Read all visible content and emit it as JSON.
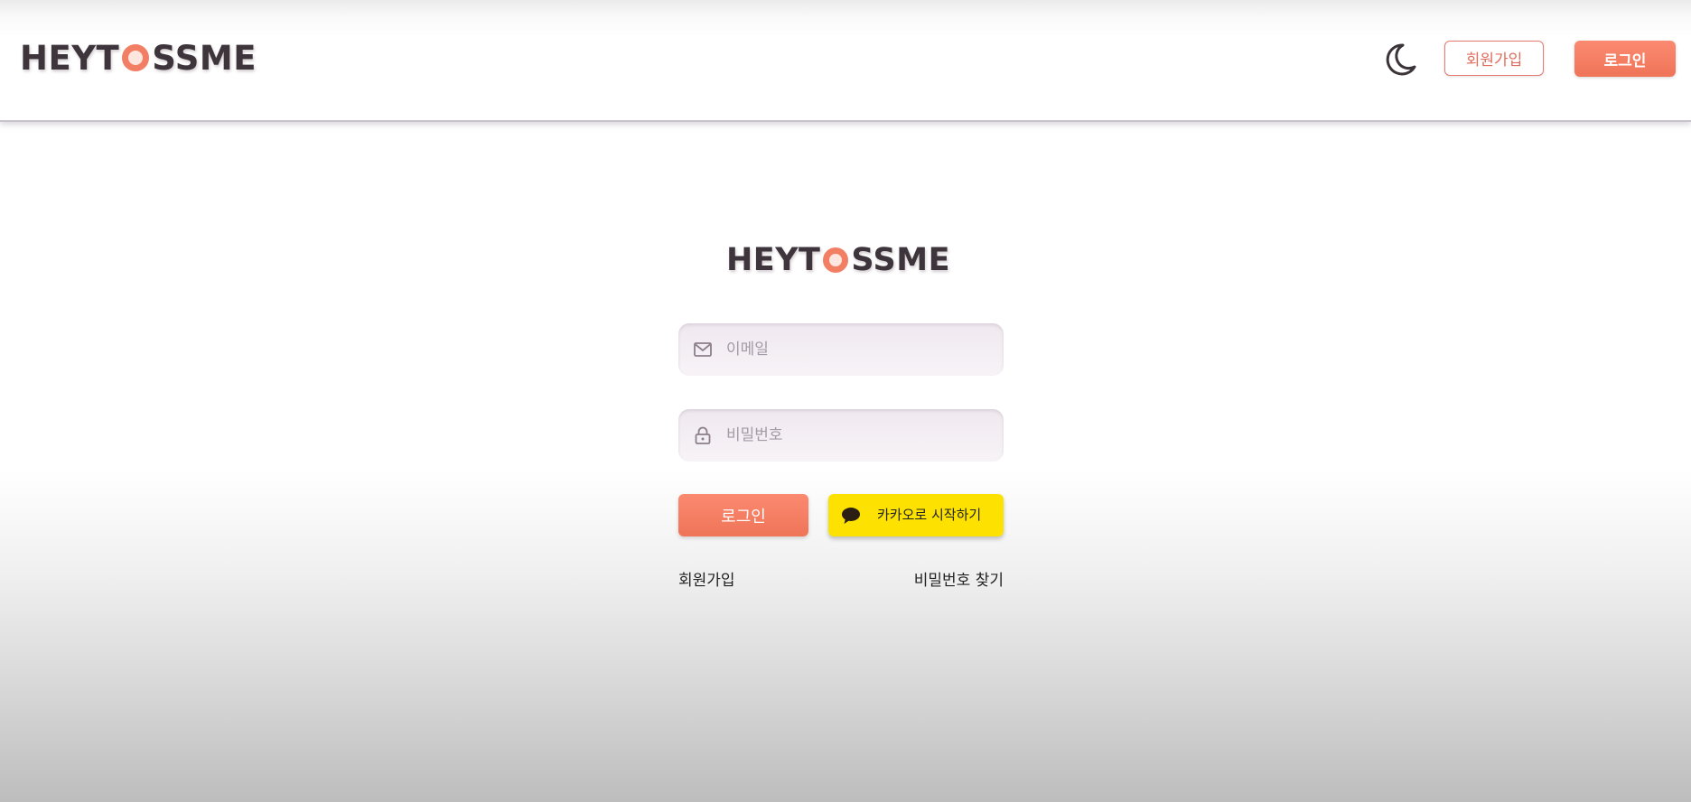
{
  "header": {
    "logo": {
      "prefix": "HEYT",
      "suffix": "SSME"
    },
    "theme_toggle_icon": "moon-icon",
    "signup_label": "회원가입",
    "login_label": "로그인"
  },
  "login_form": {
    "logo": {
      "prefix": "HEYT",
      "suffix": "SSME"
    },
    "email": {
      "icon": "mail-icon",
      "placeholder": "이메일",
      "value": ""
    },
    "password": {
      "icon": "lock-icon",
      "placeholder": "비밀번호",
      "value": ""
    },
    "login_button_label": "로그인",
    "kakao_button": {
      "icon": "kakao-chat-icon",
      "label": "카카오로 시작하기"
    },
    "signup_link": "회원가입",
    "find_password_link": "비밀번호 찾기"
  },
  "colors": {
    "brand_orange": "#f27f64",
    "kakao_yellow": "#fde100",
    "logo_text": "#3d353b"
  }
}
